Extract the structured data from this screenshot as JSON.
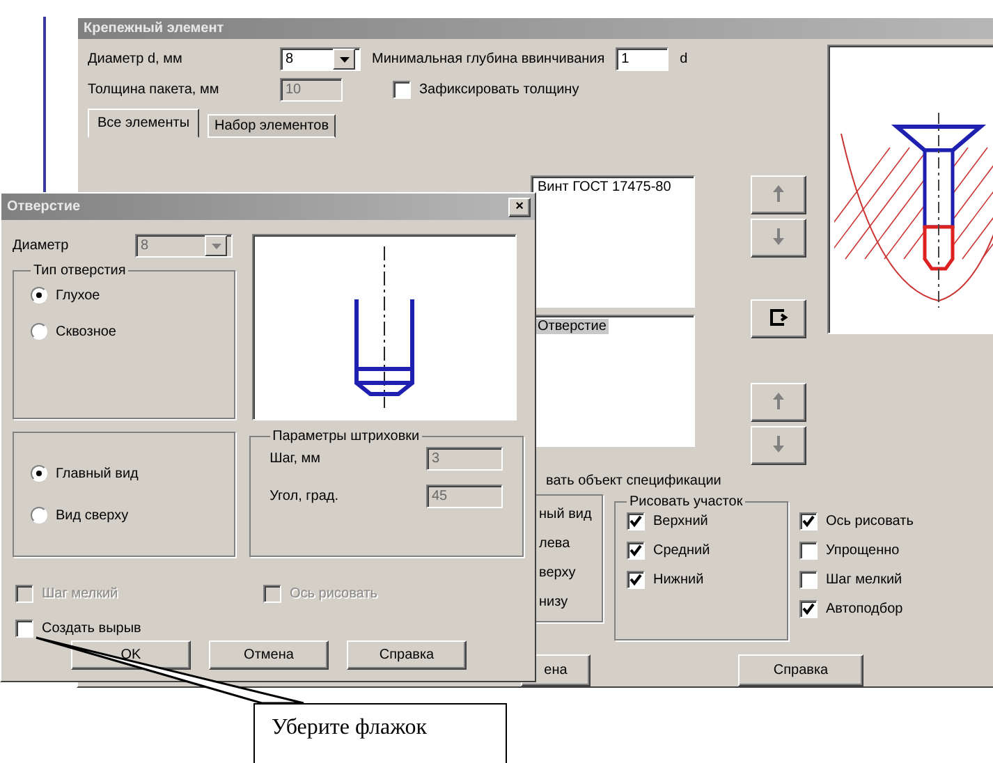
{
  "main_window": {
    "title": "Крепежный элемент",
    "diameter": {
      "label": "Диаметр d, мм",
      "value": "8"
    },
    "min_depth": {
      "label": "Минимальная глубина ввинчивания",
      "value": "1",
      "unit": "d"
    },
    "pack_thickness": {
      "label": "Толщина пакета, мм",
      "value": "10",
      "disabled": true
    },
    "fix_thickness": {
      "label": "Зафиксировать толщину",
      "checked": false
    },
    "tabs": [
      {
        "label": "Все элементы",
        "selected": true
      },
      {
        "label": "Набор элементов",
        "selected": false
      }
    ],
    "elements_list": [
      {
        "label": "Винт ГОСТ 17475-80",
        "selected": false
      }
    ],
    "parts_list": [
      {
        "label": "Отверстие",
        "selected": true
      }
    ],
    "spec_caption": "вать объект спецификации",
    "view_options_partial": [
      "ный вид",
      "лева",
      "верху",
      "низу"
    ],
    "draw_section": {
      "title": "Рисовать участок",
      "items": [
        {
          "label": "Верхний",
          "checked": true
        },
        {
          "label": "Средний",
          "checked": true
        },
        {
          "label": "Нижний",
          "checked": true
        }
      ]
    },
    "options": [
      {
        "label": "Ось рисовать",
        "checked": true
      },
      {
        "label": "Упрощенно",
        "checked": false
      },
      {
        "label": "Шаг мелкий",
        "checked": false
      },
      {
        "label": "Автоподбор",
        "checked": true
      }
    ],
    "buttons": [
      "ена",
      "Справка"
    ]
  },
  "hole_dialog": {
    "title": "Отверстие",
    "close": "×",
    "diameter": {
      "label": "Диаметр",
      "value": "8",
      "disabled": true
    },
    "hole_type": {
      "title": "Тип отверстия",
      "options": [
        {
          "label": "Глухое",
          "selected": true
        },
        {
          "label": "Сквозное",
          "selected": false
        }
      ]
    },
    "view": {
      "options": [
        {
          "label": "Главный вид",
          "selected": true
        },
        {
          "label": "Вид сверху",
          "selected": false
        }
      ]
    },
    "hatching": {
      "title": "Параметры штриховки",
      "fields": [
        {
          "label": "Шаг, мм",
          "value": "3",
          "disabled": true
        },
        {
          "label": "Угол, град.",
          "value": "45",
          "disabled": true
        }
      ]
    },
    "checkboxes": [
      {
        "label": "Шаг мелкий",
        "checked": false,
        "disabled": true
      },
      {
        "label": "Ось рисовать",
        "checked": false,
        "disabled": true
      },
      {
        "label": "Создать вырыв",
        "checked": false,
        "disabled": false
      }
    ],
    "buttons": [
      "OK",
      "Отмена",
      "Справка"
    ]
  },
  "callout": {
    "text": "Уберите флажок"
  }
}
